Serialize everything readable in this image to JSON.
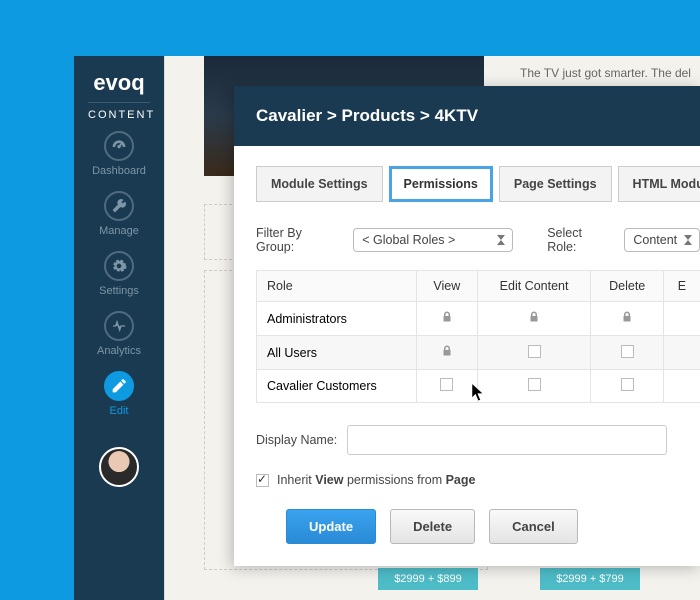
{
  "brand": {
    "name": "evoq",
    "sub": "CONTENT"
  },
  "sidebar": {
    "items": [
      {
        "label": "Dashboard"
      },
      {
        "label": "Manage"
      },
      {
        "label": "Settings"
      },
      {
        "label": "Analytics"
      },
      {
        "label": "Edit"
      }
    ]
  },
  "hero_text": "The TV just got smarter.  The del",
  "dialog": {
    "breadcrumb": "Cavalier > Products > 4KTV",
    "tabs": [
      "Module Settings",
      "Permissions",
      "Page Settings",
      "HTML Module Setting"
    ],
    "filter_label": "Filter By Group:",
    "filter_value": "< Global Roles >",
    "select_role_label": "Select Role:",
    "select_role_value": "Content",
    "table": {
      "headers": [
        "Role",
        "View",
        "Edit Content",
        "Delete",
        "E"
      ],
      "rows": [
        {
          "role": "Administrators",
          "cells": [
            "lock",
            "lock",
            "lock"
          ]
        },
        {
          "role": "All Users",
          "cells": [
            "lock",
            "box",
            "box"
          ]
        },
        {
          "role": "Cavalier Customers",
          "cells": [
            "box",
            "box",
            "box"
          ]
        }
      ]
    },
    "display_name_label": "Display Name:",
    "display_name_value": "",
    "inherit_text_pre": "Inherit ",
    "inherit_bold1": "View",
    "inherit_text_mid": " permissions from ",
    "inherit_bold2": "Page",
    "buttons": {
      "update": "Update",
      "delete": "Delete",
      "cancel": "Cancel"
    }
  },
  "prices": [
    "$2999 + $899",
    "$2999 + $799"
  ]
}
